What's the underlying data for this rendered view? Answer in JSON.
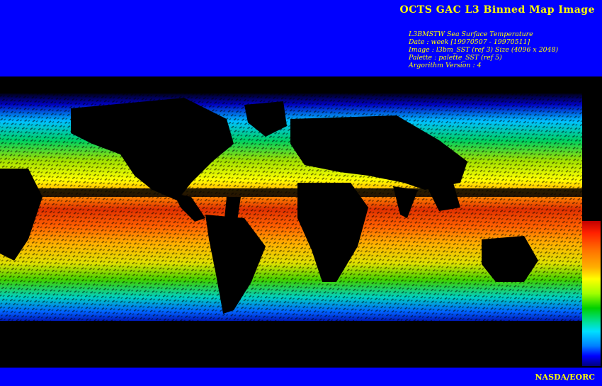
{
  "header": {
    "title": "OCTS GAC L3 Binned Map Image",
    "meta_lines": [
      "L3BMSTW Sea Surface Temperature",
      "Date : week [19970507 - 19970511]",
      "Image : l3bm_SST (ref 3) Size (4096 x 2048)",
      "Palette : palette_SST (ref 5)",
      "Argorithm Version : 4"
    ]
  },
  "footer": {
    "credit": "NASDA/EORC"
  },
  "colors": {
    "frame": "#0000ff",
    "text": "#ffff00",
    "background": "#000000"
  },
  "legend": {
    "type": "vertical color bar",
    "palette": [
      "#c00000",
      "#ff7000",
      "#ffff00",
      "#00d000",
      "#00e0ff",
      "#0000ff",
      "#000080"
    ]
  }
}
